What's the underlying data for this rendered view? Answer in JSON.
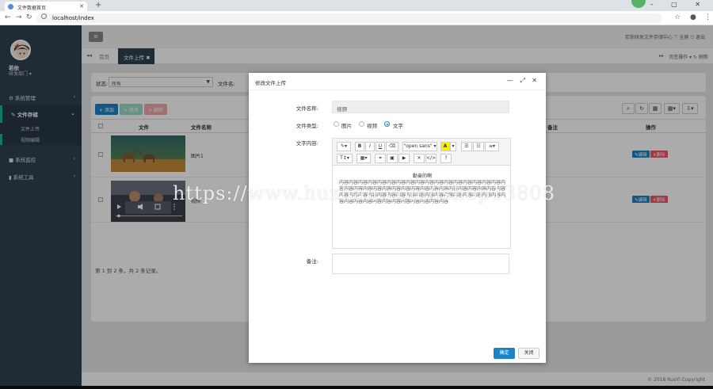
{
  "browser": {
    "tab_title": "文件数据首页",
    "url": "localhost/index",
    "newtab": "+",
    "window_controls": "– ▢ ✕"
  },
  "sidebar": {
    "user_name": "若依",
    "user_dept": "研发部门 ▾",
    "menu": [
      {
        "label": "系统管理",
        "chev": "‹"
      },
      {
        "label": "文件存储",
        "chev": "⌄"
      },
      {
        "label": "系统监控",
        "chev": "‹"
      },
      {
        "label": "系统工具",
        "chev": "‹"
      }
    ],
    "sub_items": [
      "文件上传",
      "视频编辑"
    ]
  },
  "header": {
    "menu_button": "≡",
    "right_links": "若依研发文件存储中心   ⤧ 全屏   ⎋ 退出"
  },
  "page_tabs": {
    "prev": "◂◂",
    "home": "首页",
    "active": "文件上传",
    "next": "▸▸",
    "right": "页签操作 ▾   ↻ 刷新"
  },
  "search": {
    "status_label": "状态:",
    "status_value": "所有",
    "file_label": "文件名:"
  },
  "toolbar": {
    "add": "+ 添加",
    "edit": "✎ 修改",
    "delete": "✕ 删除",
    "tools": [
      "⌕",
      "↻",
      "▦",
      "▦▾",
      "⇩▾"
    ]
  },
  "table": {
    "headers": [
      "",
      "文件",
      "文件名称",
      "备注",
      "操作"
    ],
    "rows": [
      {
        "name": "图片1",
        "edit": "✎编辑",
        "del": "✕删除"
      },
      {
        "name": "视频",
        "edit": "✎编辑",
        "del": "✕删除"
      }
    ],
    "pagination": "第 1 到 2 条，共 2 条记录。"
  },
  "modal": {
    "title": "修改文件上传",
    "controls": "— ⤢ ✕",
    "name_label": "文件名称:",
    "name_value": "视频",
    "type_label": "文件类型:",
    "type_options": [
      "图片",
      "视频",
      "文字"
    ],
    "content_label": "文字内容:",
    "editor_tools_row1": [
      "✎▾",
      "B",
      "I",
      "U",
      "⌫",
      "\"open sans\" ▾",
      "A",
      "▾",
      "☰",
      "☷",
      "≡▾"
    ],
    "editor_tools_row2": [
      "T↕▾",
      "▦▾",
      "⚭",
      "▣",
      "▶",
      "✕",
      "</>",
      "?"
    ],
    "editor_heading": "勤奋的啊",
    "editor_text": "内容内容内容内容内容内容内容内容内容内容内容内容内容内容内容内容内容内容内容内容内容内容内容内容内容内容内容内容内容内容内容内容内容内容内容内容内容内容内容内容内容内容内容内容内容内容内容内容内容内容内容内容内容内容内容内容内容内容内容内容内容内容内容内容",
    "remark_label": "备注:",
    "ok": "确定",
    "close": "关闭"
  },
  "footer": {
    "copyright": "© 2018 RuoYi Copyright"
  },
  "watermark": "https://www.huzhan.com/ishop13808"
}
